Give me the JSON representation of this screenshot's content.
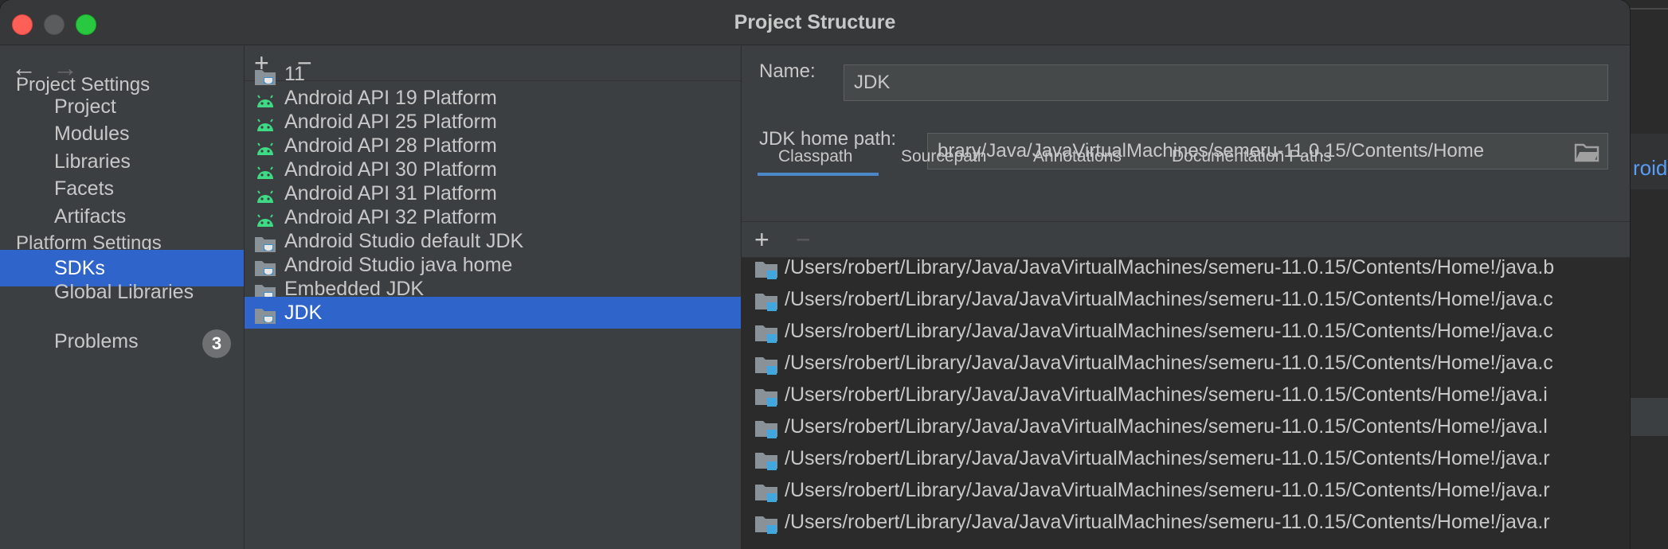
{
  "window": {
    "title": "Project Structure"
  },
  "nav": {
    "back_icon": "arrow-left-icon",
    "forward_icon": "arrow-right-icon",
    "project_settings_label": "Project Settings",
    "project_items": [
      "Project",
      "Modules",
      "Libraries",
      "Facets",
      "Artifacts"
    ],
    "platform_settings_label": "Platform Settings",
    "platform_items": [
      "SDKs",
      "Global Libraries"
    ],
    "selected": "SDKs",
    "problems_label": "Problems",
    "problems_count": "3"
  },
  "sdk_list": {
    "add_label": "+",
    "remove_label": "−",
    "items": [
      {
        "label": "11",
        "icon": "jdk-folder-icon"
      },
      {
        "label": "Android API 19 Platform",
        "icon": "android-icon"
      },
      {
        "label": "Android API 25 Platform",
        "icon": "android-icon"
      },
      {
        "label": "Android API 28 Platform",
        "icon": "android-icon"
      },
      {
        "label": "Android API 30 Platform",
        "icon": "android-icon"
      },
      {
        "label": "Android API 31 Platform",
        "icon": "android-icon"
      },
      {
        "label": "Android API 32 Platform",
        "icon": "android-icon"
      },
      {
        "label": "Android Studio default JDK",
        "icon": "jdk-folder-icon"
      },
      {
        "label": "Android Studio java home",
        "icon": "jdk-folder-icon"
      },
      {
        "label": "Embedded JDK",
        "icon": "jdk-folder-icon"
      },
      {
        "label": "JDK",
        "icon": "jdk-folder-icon"
      }
    ],
    "selected": "JDK"
  },
  "detail": {
    "name_label": "Name:",
    "name_value": "JDK",
    "home_path_label": "JDK home path:",
    "home_path_value": "brary/Java/JavaVirtualMachines/semeru-11.0.15/Contents/Home",
    "tabs": [
      "Classpath",
      "Sourcepath",
      "Annotations",
      "Documentation Paths"
    ],
    "active_tab": "Classpath",
    "add_label": "+",
    "remove_label": "−",
    "paths": [
      "/Users/robert/Library/Java/JavaVirtualMachines/semeru-11.0.15/Contents/Home!/java.b",
      "/Users/robert/Library/Java/JavaVirtualMachines/semeru-11.0.15/Contents/Home!/java.c",
      "/Users/robert/Library/Java/JavaVirtualMachines/semeru-11.0.15/Contents/Home!/java.c",
      "/Users/robert/Library/Java/JavaVirtualMachines/semeru-11.0.15/Contents/Home!/java.c",
      "/Users/robert/Library/Java/JavaVirtualMachines/semeru-11.0.15/Contents/Home!/java.i",
      "/Users/robert/Library/Java/JavaVirtualMachines/semeru-11.0.15/Contents/Home!/java.l",
      "/Users/robert/Library/Java/JavaVirtualMachines/semeru-11.0.15/Contents/Home!/java.r",
      "/Users/robert/Library/Java/JavaVirtualMachines/semeru-11.0.15/Contents/Home!/java.r",
      "/Users/robert/Library/Java/JavaVirtualMachines/semeru-11.0.15/Contents/Home!/java.r"
    ]
  },
  "background": {
    "text": "roid"
  },
  "colors": {
    "selection": "#2f65ca",
    "android": "#3ddc84",
    "badge": "#6e7072"
  }
}
